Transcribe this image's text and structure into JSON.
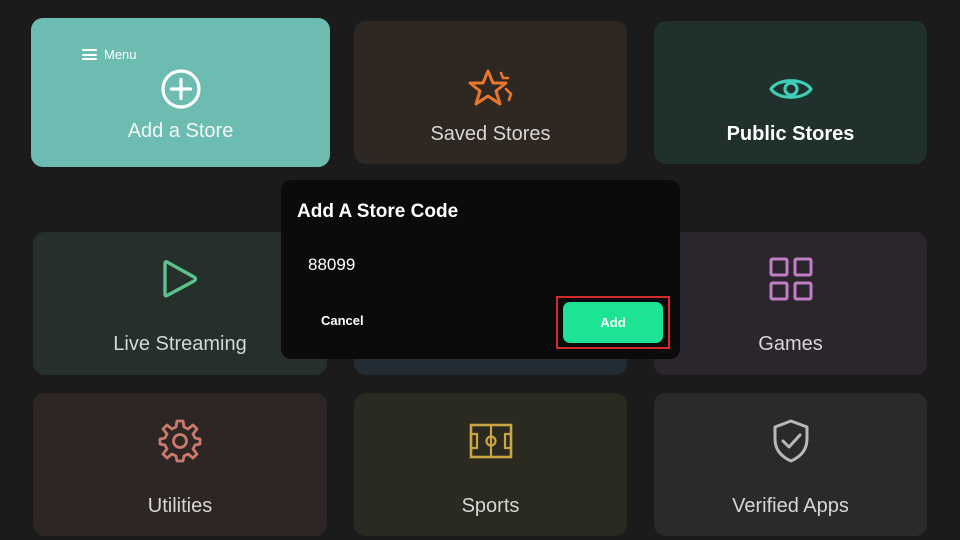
{
  "menu": {
    "label": "Menu",
    "icon": "hamburger-menu-icon"
  },
  "tiles": {
    "add_store": {
      "label": "Add a Store",
      "icon": "plus-circle-icon",
      "color": "#6dbcb2"
    },
    "saved_stores": {
      "label": "Saved Stores",
      "icon": "star-icon",
      "color": "#e8762f"
    },
    "public_stores": {
      "label": "Public Stores",
      "icon": "eye-icon",
      "color": "#3ecfb8"
    },
    "live_streaming": {
      "label": "Live Streaming",
      "icon": "play-icon",
      "color": "#5cc18c"
    },
    "games": {
      "label": "Games",
      "icon": "grid-icon",
      "color": "#c27fc4"
    },
    "utilities": {
      "label": "Utilities",
      "icon": "gear-icon",
      "color": "#c97a6c"
    },
    "sports": {
      "label": "Sports",
      "icon": "football-field-icon",
      "color": "#c9a544"
    },
    "verified_apps": {
      "label": "Verified Apps",
      "icon": "shield-check-icon",
      "color": "#b9b9b9"
    }
  },
  "dialog": {
    "title": "Add A Store Code",
    "code_value": "88099",
    "cancel_label": "Cancel",
    "add_label": "Add",
    "add_color": "#1de394",
    "focus_color": "#d42a2a"
  }
}
